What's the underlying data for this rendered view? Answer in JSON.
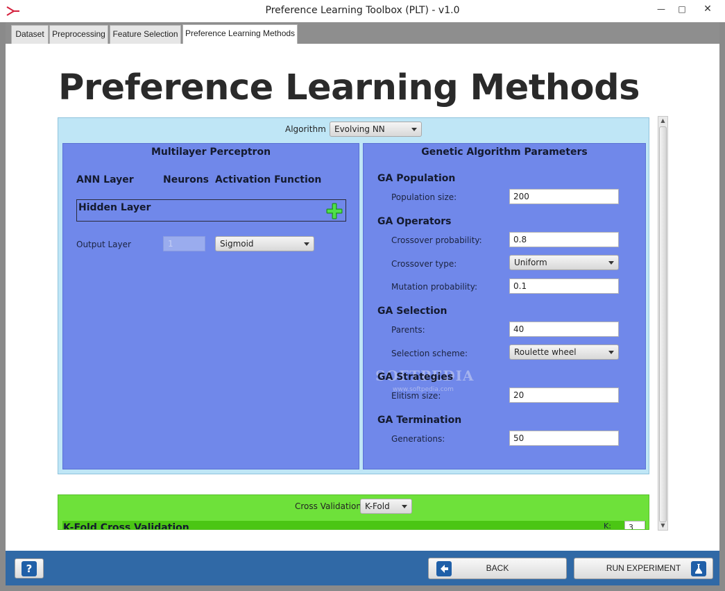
{
  "window": {
    "title": "Preference Learning Toolbox (PLT) - v1.0",
    "minimize_glyph": "—",
    "maximize_glyph": "□",
    "close_glyph": "✕"
  },
  "tabs": [
    {
      "label": "Dataset",
      "active": false
    },
    {
      "label": "Preprocessing",
      "active": false
    },
    {
      "label": "Feature Selection",
      "active": false
    },
    {
      "label": "Preference Learning Methods",
      "active": true
    }
  ],
  "page": {
    "title": "Preference Learning Methods"
  },
  "algorithm": {
    "label": "Algorithm",
    "selected": "Evolving NN"
  },
  "mlp": {
    "title": "Multilayer Perceptron",
    "col_layer": "ANN Layer",
    "col_neurons": "Neurons",
    "col_activation": "Activation Function",
    "hidden_layer_label": "Hidden Layer",
    "output_layer_label": "Output Layer",
    "output_neurons": "1",
    "output_activation": "Sigmoid"
  },
  "ga": {
    "title": "Genetic Algorithm Parameters",
    "population_section": "GA Population",
    "population_size_label": "Population size:",
    "population_size": "200",
    "operators_section": "GA Operators",
    "crossover_prob_label": "Crossover probability:",
    "crossover_prob": "0.8",
    "crossover_type_label": "Crossover type:",
    "crossover_type": "Uniform",
    "mutation_prob_label": "Mutation probability:",
    "mutation_prob": "0.1",
    "selection_section": "GA Selection",
    "parents_label": "Parents:",
    "parents": "40",
    "selection_scheme_label": "Selection scheme:",
    "selection_scheme": "Roulette wheel",
    "strategies_section": "GA Strategies",
    "elitism_label": "Elitism size:",
    "elitism": "20",
    "termination_section": "GA Termination",
    "generations_label": "Generations:",
    "generations": "50"
  },
  "watermark": {
    "text": "SOFTPEDIA",
    "sub": "www.softpedia.com"
  },
  "cross_validation": {
    "label": "Cross Validation",
    "selected": "K-Fold",
    "section_title": "K-Fold Cross Validation",
    "k_label": "K:",
    "k_value": "3"
  },
  "bottom": {
    "help_label": "?",
    "back_label": "BACK",
    "run_label": "RUN EXPERIMENT"
  },
  "colors": {
    "mlp_panel": "#7088ea",
    "algo_panel": "#bfe6f6",
    "cv_panel": "#6ee13a",
    "bottom_bar": "#3069a6"
  }
}
